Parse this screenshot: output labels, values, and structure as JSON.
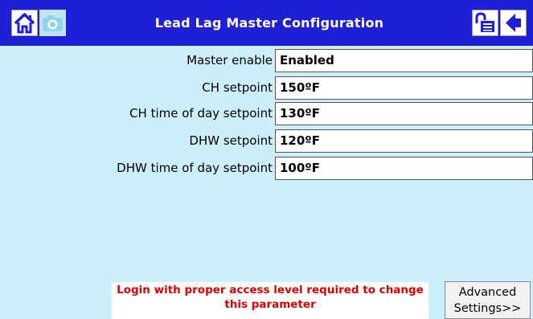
{
  "header": {
    "title": "Lead Lag Master Configuration",
    "icons": [
      "home-icon",
      "camera-icon",
      "lock-icon",
      "back-arrow-icon"
    ]
  },
  "settings": [
    {
      "label": "Master enable",
      "value": "Enabled"
    },
    {
      "label": "CH setpoint",
      "value": "150ºF"
    },
    {
      "label": "CH time of day setpoint",
      "value": "130ºF"
    },
    {
      "label": "DHW setpoint",
      "value": "120ºF"
    },
    {
      "label": "DHW time of day setpoint",
      "value": "100ºF"
    }
  ],
  "warning": {
    "line1": "Login with proper access level required to change",
    "line2": "this parameter"
  },
  "advanced_button": {
    "line1": "Advanced",
    "line2": "Settings>>"
  },
  "colors": {
    "header": "#1f1fd6",
    "background": "#cdeefb",
    "warning_text": "#e00000"
  }
}
